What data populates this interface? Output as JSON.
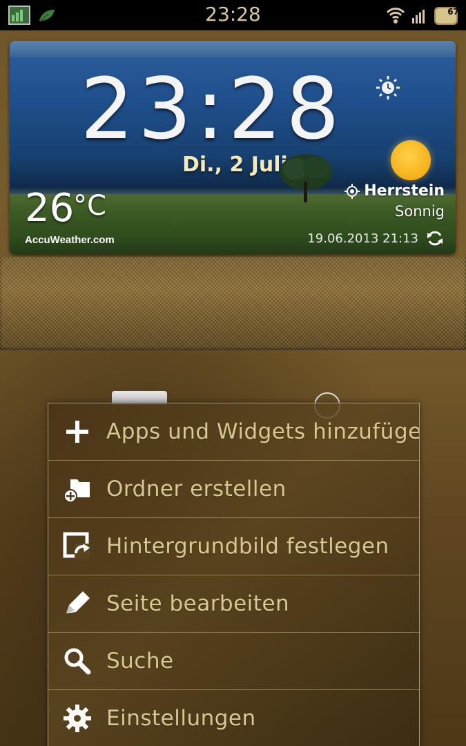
{
  "status_bar": {
    "time": "23:28",
    "battery_level": "67",
    "icons": [
      "gallery-icon",
      "leaf-icon",
      "wifi-icon",
      "signal-icon",
      "battery-icon"
    ]
  },
  "weather_widget": {
    "time": "23:28",
    "date": "Di., 2 Juli",
    "temperature": "26",
    "temperature_unit": "°C",
    "provider": "AccuWeather.com",
    "location": "Herrstein",
    "condition": "Sonnig",
    "updated": "19.06.2013 21:13",
    "icons": [
      "alarm-icon",
      "sun-icon",
      "location-icon",
      "refresh-icon"
    ]
  },
  "context_menu": {
    "items": [
      {
        "label": "Apps und Widgets hinzufügen",
        "icon": "plus-icon"
      },
      {
        "label": "Ordner erstellen",
        "icon": "add-folder-icon"
      },
      {
        "label": "Hintergrundbild festlegen",
        "icon": "wallpaper-icon"
      },
      {
        "label": "Seite bearbeiten",
        "icon": "pencil-icon"
      },
      {
        "label": "Suche",
        "icon": "search-icon"
      },
      {
        "label": "Einstellungen",
        "icon": "gear-icon"
      }
    ]
  },
  "colors": {
    "menu_text": "#d9c893",
    "status_time": "#d8c9a3",
    "date_text": "#f3e9b9",
    "sun": "#f6b21a"
  }
}
